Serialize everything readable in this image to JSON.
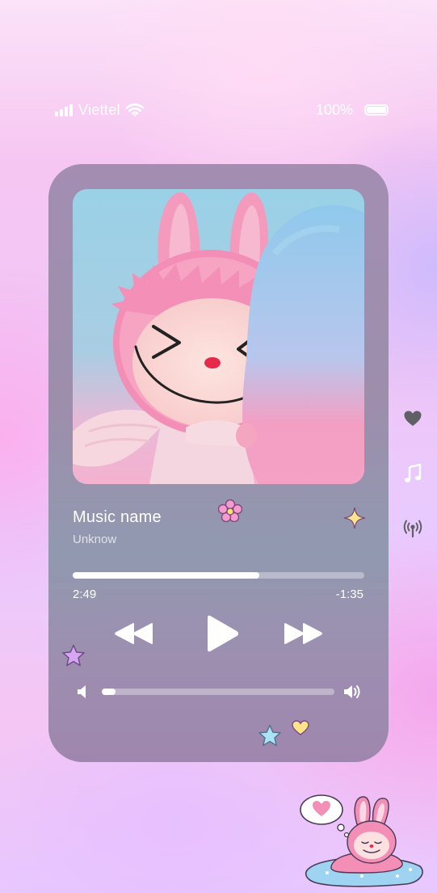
{
  "status_bar": {
    "carrier": "Viettel",
    "battery": "100%"
  },
  "player": {
    "track_title": "Music name",
    "artist": "Unknow",
    "elapsed": "2:49",
    "remaining": "-1:35",
    "progress_fraction": 0.64,
    "volume_fraction": 0.06
  },
  "icons": {
    "signal": "signal-bars-icon",
    "wifi": "wifi-icon",
    "battery": "battery-icon",
    "rewind": "rewind-icon",
    "play": "play-icon",
    "forward": "fast-forward-icon",
    "volume_low": "volume-low-icon",
    "volume_high": "volume-high-icon",
    "favorite": "heart-icon",
    "lyrics": "music-note-icon",
    "broadcast": "broadcast-icon"
  },
  "colors": {
    "card": "#9d8eac",
    "accent": "#ffffff",
    "album_bg": "#8dc7de",
    "character_pink": "#f07fb4"
  }
}
